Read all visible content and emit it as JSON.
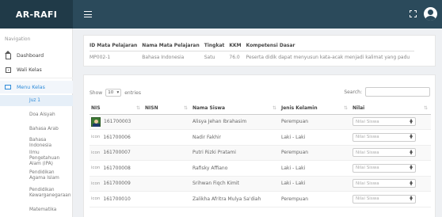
{
  "brand": "AR-RAFI",
  "sidebar": {
    "section_label": "Navigation",
    "items": [
      {
        "label": "Dashboard",
        "icon": "home-icon"
      },
      {
        "label": "Wali Kelas",
        "icon": "grid-icon"
      },
      {
        "label": "Menu Kelas",
        "icon": "menu-icon"
      }
    ],
    "sub_items": [
      "Juz 1",
      "Doa Aisyah",
      "Bahasa Arab",
      "Bahasa Indonesia",
      "Ilmu Pengetahuan Alam (IPA)",
      "Pendidikan Agama Islam",
      "Pendidikan Kewarganegaraan",
      "Matematika"
    ]
  },
  "info": {
    "headers": [
      "ID Mata Pelajaran",
      "Nama Mata Pelajaran",
      "Tingkat",
      "KKM",
      "Kompetensi Dasar"
    ],
    "row": [
      "MP002-1",
      "Bahasa Indonesia",
      "Satu",
      "76.0",
      "Peserta didik dapat menyusun kata-acak menjadi kalimat yang padu"
    ]
  },
  "table_controls": {
    "show_label": "Show",
    "entries_value": "10",
    "entries_label": "entries",
    "search_label": "Search:"
  },
  "table": {
    "headers": [
      "NIS",
      "NISN",
      "Nama Siswa",
      "Jenis Kelamin",
      "Nilai"
    ],
    "nilai_placeholder": "Nilai Siswa",
    "rows": [
      {
        "photo": true,
        "icon_text": "",
        "nis": "161700003",
        "nisn": "",
        "nama": "Alisya Jehan Ibrahasim",
        "jk": "Perempuan"
      },
      {
        "photo": false,
        "icon_text": "icon",
        "nis": "161700006",
        "nisn": "",
        "nama": "Nadir Fakhir",
        "jk": "Laki - Laki"
      },
      {
        "photo": false,
        "icon_text": "icon",
        "nis": "161700007",
        "nisn": "",
        "nama": "Putri Rizki Pratami",
        "jk": "Perempuan"
      },
      {
        "photo": false,
        "icon_text": "icon",
        "nis": "161700008",
        "nisn": "",
        "nama": "Rafisky Affiano",
        "jk": "Laki - Laki"
      },
      {
        "photo": false,
        "icon_text": "icon",
        "nis": "161700009",
        "nisn": "",
        "nama": "Srihwan Fiqch Kimit",
        "jk": "Laki - Laki"
      },
      {
        "photo": false,
        "icon_text": "icon",
        "nis": "161700010",
        "nisn": "",
        "nama": "Zalikha Afritra Mulya Sa'diah",
        "jk": "Perempuan"
      }
    ]
  }
}
